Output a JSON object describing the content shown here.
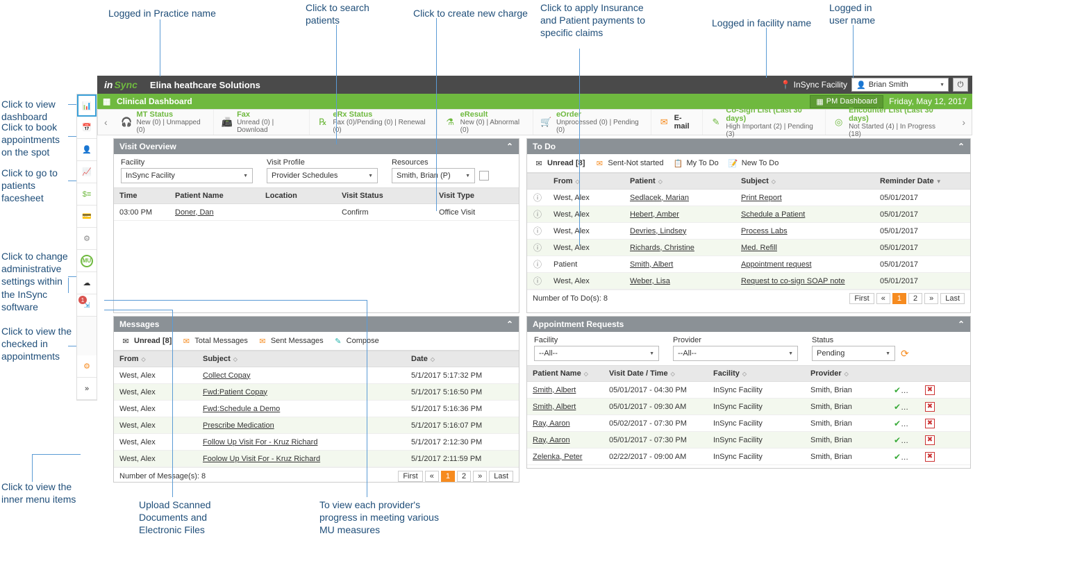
{
  "annotations": {
    "practice": "Logged in Practice name",
    "search_patients": "Click to search patients",
    "new_charge": "Click to create new charge",
    "apply_payments": "Click to apply Insurance and Patient payments to specific claims",
    "facility": "Logged in facility name",
    "user": "Logged in user name",
    "view_dashboard": "Click to view dashboard",
    "book_appts": "Click to book appointments on the spot",
    "patients_facesheet": "Click to go to patients facesheet",
    "admin_settings": "Click to change administrative settings within the InSync software",
    "checked_in": "Click to view the checked in appointments",
    "inner_menu": "Click to view the inner menu items",
    "upload_docs": "Upload Scanned Documents and Electronic Files",
    "mu_measures": "To view each provider's progress in meeting various MU measures"
  },
  "topbar": {
    "logo_in": "in",
    "logo_sync": "Sync",
    "practice": "Elina heathcare Solutions",
    "facility": "InSync Facility",
    "user": "Brian Smith"
  },
  "greenbar": {
    "title": "Clinical Dashboard",
    "pm": "PM Dashboard",
    "date": "Friday, May 12, 2017"
  },
  "status": {
    "mt": {
      "title": "MT Status",
      "sub": "New (0) | Unmapped (0)"
    },
    "fax": {
      "title": "Fax",
      "sub": "Unread (0) | Download"
    },
    "erx": {
      "title": "eRx Status",
      "sub": "Fax (0)/Pending (0) | Renewal (0)"
    },
    "eresult": {
      "title": "eResult",
      "sub": "New (0) | Abnormal (0)"
    },
    "eorder": {
      "title": "eOrder",
      "sub": "Unprocessed (0) | Pending (0)"
    },
    "email": {
      "title": "E-mail",
      "sub": ""
    },
    "cosign": {
      "title": "Co-Sign List (Last 30 days)",
      "sub": "High Important (2) | Pending (3)"
    },
    "encounter": {
      "title": "Encounter List (Last 30 days)",
      "sub": "Not Started (4) | In Progress (18)"
    }
  },
  "visit_overview": {
    "title": "Visit Overview",
    "labels": {
      "facility": "Facility",
      "profile": "Visit Profile",
      "resources": "Resources"
    },
    "facility": "InSync Facility",
    "profile": "Provider Schedules",
    "resource": "Smith, Brian (P)",
    "columns": {
      "time": "Time",
      "patient": "Patient Name",
      "location": "Location",
      "status": "Visit Status",
      "type": "Visit Type"
    },
    "rows": [
      {
        "time": "03:00 PM",
        "patient": "Doner, Dan",
        "location": "",
        "status": "Confirm",
        "type": "Office Visit"
      }
    ]
  },
  "todo": {
    "title": "To Do",
    "tabs": {
      "unread": "Unread [8]",
      "sent": "Sent-Not started",
      "mytodo": "My To Do",
      "new": "New To Do"
    },
    "columns": {
      "from": "From",
      "patient": "Patient",
      "subject": "Subject",
      "reminder": "Reminder Date"
    },
    "rows": [
      {
        "from": "West, Alex",
        "patient": "Sedlacek, Marian",
        "subject": "Print Report",
        "date": "05/01/2017"
      },
      {
        "from": "West, Alex",
        "patient": "Hebert, Amber",
        "subject": "Schedule a Patient",
        "date": "05/01/2017"
      },
      {
        "from": "West, Alex",
        "patient": "Devries, Lindsey",
        "subject": "Process Labs",
        "date": "05/01/2017"
      },
      {
        "from": "West, Alex",
        "patient": "Richards, Christine",
        "subject": "Med. Refill",
        "date": "05/01/2017"
      },
      {
        "from": "Patient",
        "patient": "Smith, Albert",
        "subject": "Appointment request",
        "date": "05/01/2017"
      },
      {
        "from": "West, Alex",
        "patient": "Weber, Lisa",
        "subject": "Request to co-sign SOAP note",
        "date": "05/01/2017"
      }
    ],
    "count_label": "Number of To Do(s): 8",
    "pager": {
      "first": "First",
      "last": "Last"
    }
  },
  "messages": {
    "title": "Messages",
    "tabs": {
      "unread": "Unread [8]",
      "total": "Total Messages",
      "sent": "Sent Messages",
      "compose": "Compose"
    },
    "columns": {
      "from": "From",
      "subject": "Subject",
      "date": "Date"
    },
    "rows": [
      {
        "from": "West, Alex",
        "subject": "Collect Copay",
        "date": "5/1/2017 5:17:32 PM"
      },
      {
        "from": "West, Alex",
        "subject": "Fwd:Patient Copay",
        "date": "5/1/2017 5:16:50 PM"
      },
      {
        "from": "West, Alex",
        "subject": "Fwd:Schedule a Demo",
        "date": "5/1/2017 5:16:36 PM"
      },
      {
        "from": "West, Alex",
        "subject": "Prescribe Medication",
        "date": "5/1/2017 5:16:07 PM"
      },
      {
        "from": "West, Alex",
        "subject": "Follow Up Visit For - Kruz Richard",
        "date": "5/1/2017 2:12:30 PM"
      },
      {
        "from": "West, Alex",
        "subject": "Foolow Up Visit For - Kruz Richard",
        "date": "5/1/2017 2:11:59 PM"
      }
    ],
    "count_label": "Number of Message(s): 8",
    "pager": {
      "first": "First",
      "last": "Last"
    }
  },
  "appt_requests": {
    "title": "Appointment Requests",
    "labels": {
      "facility": "Facility",
      "provider": "Provider",
      "status": "Status"
    },
    "facility": "--All--",
    "provider": "--All--",
    "status": "Pending",
    "columns": {
      "patient": "Patient Name",
      "visit": "Visit Date / Time",
      "facility": "Facility",
      "provider": "Provider"
    },
    "rows": [
      {
        "patient": "Smith, Albert",
        "visit": "05/01/2017 - 04:30 PM",
        "facility": "InSync Facility",
        "provider": "Smith, Brian"
      },
      {
        "patient": "Smith, Albert",
        "visit": "05/01/2017 - 09:30 AM",
        "facility": "InSync Facility",
        "provider": "Smith, Brian"
      },
      {
        "patient": "Ray, Aaron",
        "visit": "05/02/2017 - 07:30 PM",
        "facility": "InSync Facility",
        "provider": "Smith, Brian"
      },
      {
        "patient": "Ray, Aaron",
        "visit": "05/01/2017 - 07:30 PM",
        "facility": "InSync Facility",
        "provider": "Smith, Brian"
      },
      {
        "patient": "Zelenka, Peter",
        "visit": "02/22/2017 - 09:00 AM",
        "facility": "InSync Facility",
        "provider": "Smith, Brian"
      }
    ]
  }
}
